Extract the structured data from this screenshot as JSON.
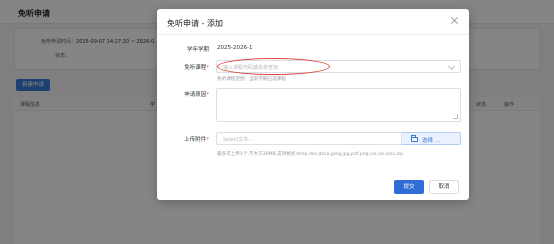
{
  "background": {
    "title": "免听申请",
    "filter_time_label": "免听申请时间：",
    "filter_time_value": "2025-09-07 14:27:20 ~ 2026-0",
    "filter_status_label": "状态：",
    "new_button": "新建申请",
    "table_headers": [
      "课程信息",
      "学",
      "状态",
      "操作"
    ]
  },
  "dialog": {
    "title": "免听申请 - 添加",
    "term_label": "学年学期",
    "term_value": "2025-2026-1",
    "course_label": "免听课程",
    "course_placeholder": "输入课程代码或名称查询",
    "course_hint": "免听课程范围：当前学期已选课程",
    "reason_label": "申请原因",
    "attach_label": "上传附件",
    "attach_placeholder": "Select文件...",
    "pick_button": "选择 ...",
    "attach_hint": "最多可上传1个,不大于20MB,支持格式:bmp,doc,docx,jpeg,jpg,pdf,png,rar,xls,xlsx,zip",
    "required_mark": "*",
    "submit_button": "提交",
    "cancel_button": "取消"
  },
  "colors": {
    "primary": "#2f6cd6",
    "required": "#e34d59",
    "highlight_oval": "#e0443c",
    "overlay": "rgba(0,0,0,0.48)"
  },
  "icons": {
    "close": "close-icon",
    "dropdown": "chevron-down-icon",
    "folder": "folder-icon"
  }
}
